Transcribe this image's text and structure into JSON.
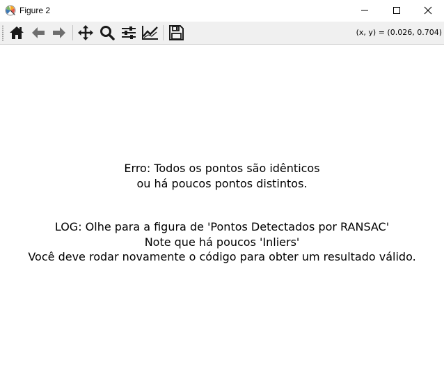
{
  "window": {
    "title": "Figure 2"
  },
  "toolbar": {
    "buttons": [
      {
        "name": "home",
        "icon": "home-icon"
      },
      {
        "name": "back",
        "icon": "arrow-left-icon"
      },
      {
        "name": "forward",
        "icon": "arrow-right-icon"
      },
      {
        "name": "pan",
        "icon": "move-icon"
      },
      {
        "name": "zoom",
        "icon": "magnifier-icon"
      },
      {
        "name": "subplots",
        "icon": "sliders-icon"
      },
      {
        "name": "edit-axes",
        "icon": "line-chart-icon"
      },
      {
        "name": "save",
        "icon": "floppy-disk-icon"
      }
    ],
    "coordinates": "(x, y) = (0.026, 0.704)"
  },
  "figure": {
    "error_lines": [
      "Erro: Todos os pontos são idênticos",
      "ou há poucos pontos distintos."
    ],
    "log_lines": [
      "LOG: Olhe para a figura de 'Pontos Detectados por RANSAC'",
      "Note que há poucos 'Inliers'",
      "Você deve rodar novamente o código para obter um resultado válido."
    ]
  },
  "colors": {
    "toolbar_bg": "#f0f0f0",
    "canvas_bg": "#ffffff",
    "icon": "#1a1a1a"
  }
}
